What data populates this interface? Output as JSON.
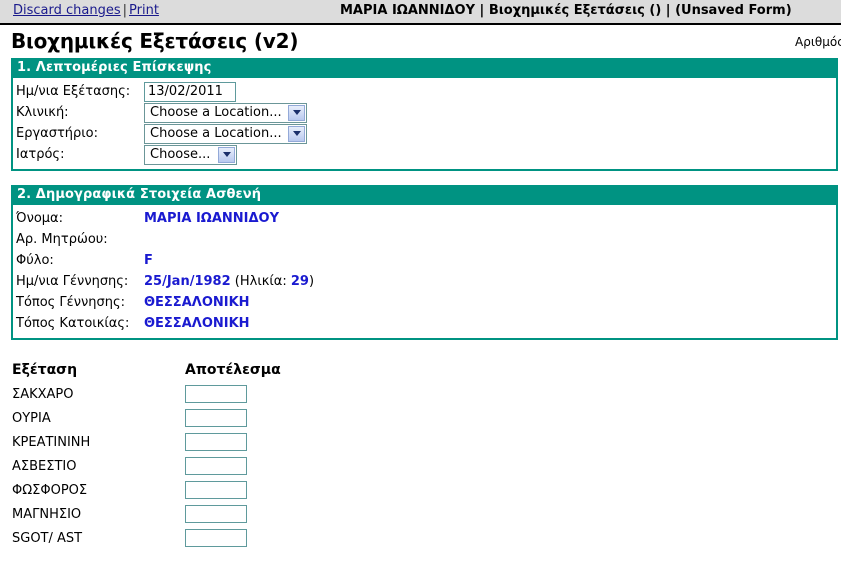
{
  "topbar": {
    "discard_label": "Discard changes",
    "separator": "|",
    "print_label": "Print",
    "breadcrumb": "ΜΑΡΙΑ ΙΩΑΝΝΙΔΟΥ | Βιοχημικές Εξετάσεις () | (Unsaved Form)"
  },
  "header": {
    "page_title": "Βιοχημικές Εξετάσεις (v2)",
    "corner_label": "Αριθμός"
  },
  "section1": {
    "title": "1. Λεπτομέριες Επίσκεψης",
    "fields": [
      {
        "label": "Ημ/νια Εξέτασης:",
        "type": "text",
        "value": "13/02/2011"
      },
      {
        "label": "Κλινική:",
        "type": "select",
        "value": "Choose a Location...",
        "width": "wide"
      },
      {
        "label": "Εργαστήριο:",
        "type": "select",
        "value": "Choose a Location...",
        "width": "wide"
      },
      {
        "label": "Ιατρός:",
        "type": "select",
        "value": "Choose...",
        "width": "narrow"
      }
    ]
  },
  "section2": {
    "title": "2. Δημογραφικά Στοιχεία Ασθενή",
    "fields": [
      {
        "label": "Όνομα:",
        "value": "ΜΑΡΙΑ ΙΩΑΝΝΙΔΟΥ"
      },
      {
        "label": "Αρ. Μητρώου:",
        "value": ""
      },
      {
        "label": "Φύλο:",
        "value": "F"
      },
      {
        "label": "Ημ/νια Γέννησης:",
        "value": "25/Jan/1982",
        "suffix_plain": " (Ηλικία: ",
        "suffix_bold": "29",
        "suffix_end": ")"
      },
      {
        "label": "Τόπος Γέννησης:",
        "value": "ΘΕΣΣΑΛΟΝΙΚΗ"
      },
      {
        "label": "Τόπος Κατοικίας:",
        "value": "ΘΕΣΣΑΛΟΝΙΚΗ"
      }
    ]
  },
  "exam_table": {
    "col_exam": "Εξέταση",
    "col_result": "Αποτέλεσμα",
    "rows": [
      {
        "name": "ΣΑΚΧΑΡΟ",
        "value": ""
      },
      {
        "name": "ΟΥΡΙΑ",
        "value": ""
      },
      {
        "name": "ΚΡΕΑΤΙΝΙΝΗ",
        "value": ""
      },
      {
        "name": "ΑΣΒΕΣΤΙΟ",
        "value": ""
      },
      {
        "name": "ΦΩΣΦΟΡΟΣ",
        "value": ""
      },
      {
        "name": "ΜΑΓΝΗΣΙΟ",
        "value": ""
      },
      {
        "name": "SGOT/ AST",
        "value": ""
      }
    ]
  },
  "colors": {
    "section_teal": "#009382",
    "value_blue": "#1a1ad0",
    "link_blue": "#1a1a8c",
    "topbar_gray": "#dcdcdc",
    "input_border": "#5f9a9c"
  }
}
